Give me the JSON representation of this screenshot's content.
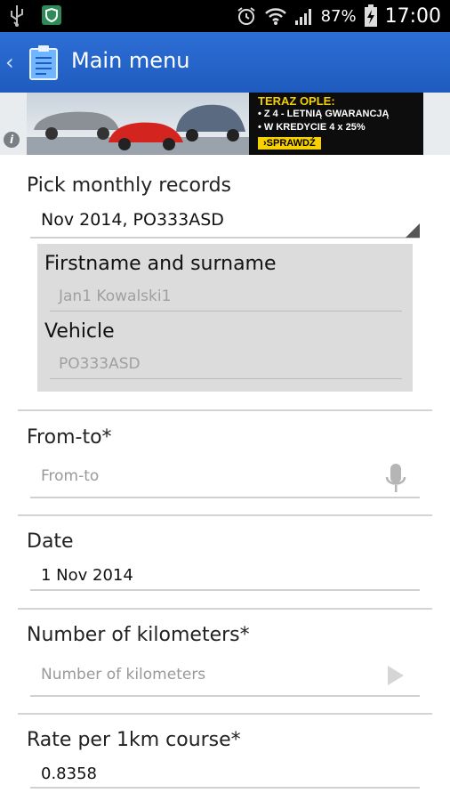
{
  "status_bar": {
    "battery_percent": "87%",
    "time": "17:00",
    "icons": [
      "usb-icon",
      "shield-app-icon",
      "alarm-icon",
      "wifi-icon",
      "signal-icon",
      "battery-icon"
    ]
  },
  "action_bar": {
    "title": "Main menu",
    "icon": "clipboard-icon"
  },
  "ad": {
    "line1": "TERAZ OPLE:",
    "line2": "• Z 4 - LETNIĄ GWARANCJĄ",
    "line3": "• W KREDYCIE 4 x 25%",
    "button": "›SPRAWDŹ",
    "info": "i"
  },
  "form": {
    "monthly_records": {
      "label": "Pick monthly records",
      "selected": "Nov 2014, PO333ASD"
    },
    "details_panel": {
      "name_label": "Firstname and surname",
      "name_value": "Jan1 Kowalski1",
      "vehicle_label": "Vehicle",
      "vehicle_value": "PO333ASD"
    },
    "from_to": {
      "label": "From-to*",
      "placeholder": "From-to"
    },
    "date": {
      "label": "Date",
      "value": "1 Nov 2014"
    },
    "kilometers": {
      "label": "Number of kilometers*",
      "placeholder": "Number of kilometers"
    },
    "rate": {
      "label": "Rate per 1km course*",
      "value": "0.8358"
    }
  },
  "colors": {
    "action_bar": "#1f5bbf",
    "ad_accent": "#f6d000"
  }
}
